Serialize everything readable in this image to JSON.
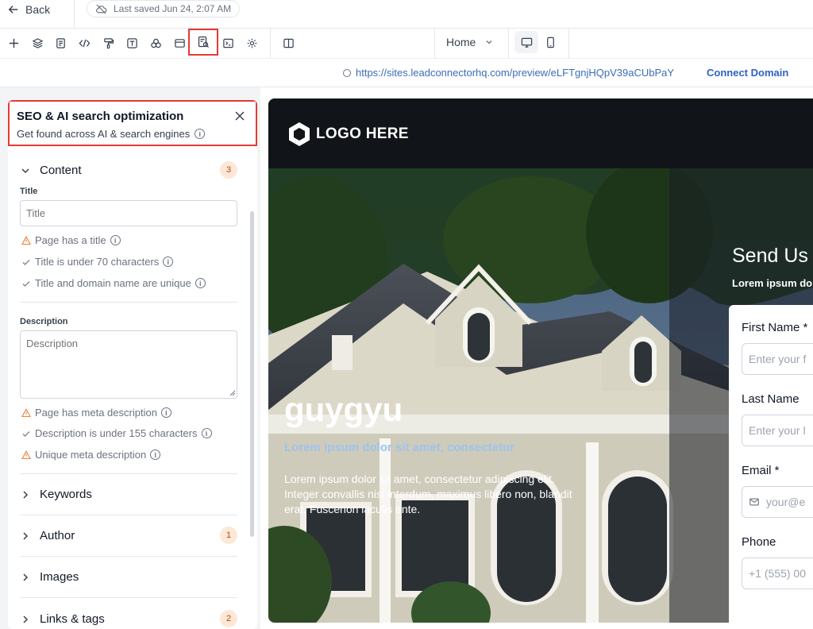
{
  "topbar": {
    "back_label": "Back",
    "saved_status": "Last saved Jun 24, 2:07 AM"
  },
  "toolbar": {
    "tools": [
      {
        "name": "add",
        "icon": "plus-icon"
      },
      {
        "name": "layers",
        "icon": "layers-icon"
      },
      {
        "name": "pages",
        "icon": "page-icon"
      },
      {
        "name": "code",
        "icon": "code-icon"
      },
      {
        "name": "paint",
        "icon": "paint-roller-icon"
      },
      {
        "name": "text",
        "icon": "text-icon"
      },
      {
        "name": "elements",
        "icon": "shapes-icon"
      },
      {
        "name": "popup",
        "icon": "window-icon"
      },
      {
        "name": "seo",
        "icon": "seo-search-icon",
        "active": true
      },
      {
        "name": "terminal",
        "icon": "terminal-icon"
      },
      {
        "name": "settings",
        "icon": "settings-icon"
      },
      {
        "name": "split",
        "icon": "columns-icon"
      }
    ],
    "page_selector": "Home",
    "devices": [
      {
        "name": "desktop",
        "icon": "monitor-icon",
        "active": true
      },
      {
        "name": "mobile",
        "icon": "smartphone-icon",
        "active": false
      }
    ]
  },
  "url_bar": {
    "url": "https://sites.leadconnectorhq.com/preview/eLFTgnjHQpV39aCUbPaY",
    "connect_label": "Connect Domain"
  },
  "seo_panel": {
    "title": "SEO & AI search optimization",
    "subtitle": "Get found across AI & search engines",
    "content": {
      "label": "Content",
      "badge": "3",
      "title_label": "Title",
      "title_placeholder": "Title",
      "title_checks": [
        {
          "text": "Page has a title",
          "status": "warning"
        },
        {
          "text": "Title is under 70 characters",
          "status": "pass"
        },
        {
          "text": "Title and domain name are unique",
          "status": "pass"
        }
      ],
      "description_label": "Description",
      "description_placeholder": "Description",
      "description_checks": [
        {
          "text": "Page has meta description",
          "status": "warning"
        },
        {
          "text": "Description is under 155 characters",
          "status": "pass"
        },
        {
          "text": "Unique meta description",
          "status": "warning"
        }
      ]
    },
    "sections": [
      {
        "label": "Keywords",
        "badge": ""
      },
      {
        "label": "Author",
        "badge": "1"
      },
      {
        "label": "Images",
        "badge": ""
      },
      {
        "label": "Links & tags",
        "badge": "2"
      }
    ]
  },
  "preview": {
    "logo_text": "LOGO HERE",
    "hero_title": "guygyu",
    "hero_subtitle": "Lorem ipsum dolor sit amet, consectetur",
    "hero_body": "Lorem ipsum dolor sit amet, consectetur adipiscing elit. Integer convallis nisi interdum, maximus libero non, blandit erat. Fuscenon iaculis ante.",
    "form_heading": "Send Us",
    "form_subheading": "Lorem ipsum do",
    "fields": [
      {
        "label": "First Name *",
        "placeholder": "Enter your f"
      },
      {
        "label": "Last Name",
        "placeholder": "Enter your l"
      },
      {
        "label": "Email *",
        "placeholder": "your@e"
      },
      {
        "label": "Phone",
        "placeholder": "+1 (555) 00"
      }
    ]
  },
  "colors": {
    "highlight": "#e53935",
    "link": "#2c63c7",
    "badge_bg": "#fde8d8",
    "warning": "#e8833a"
  }
}
